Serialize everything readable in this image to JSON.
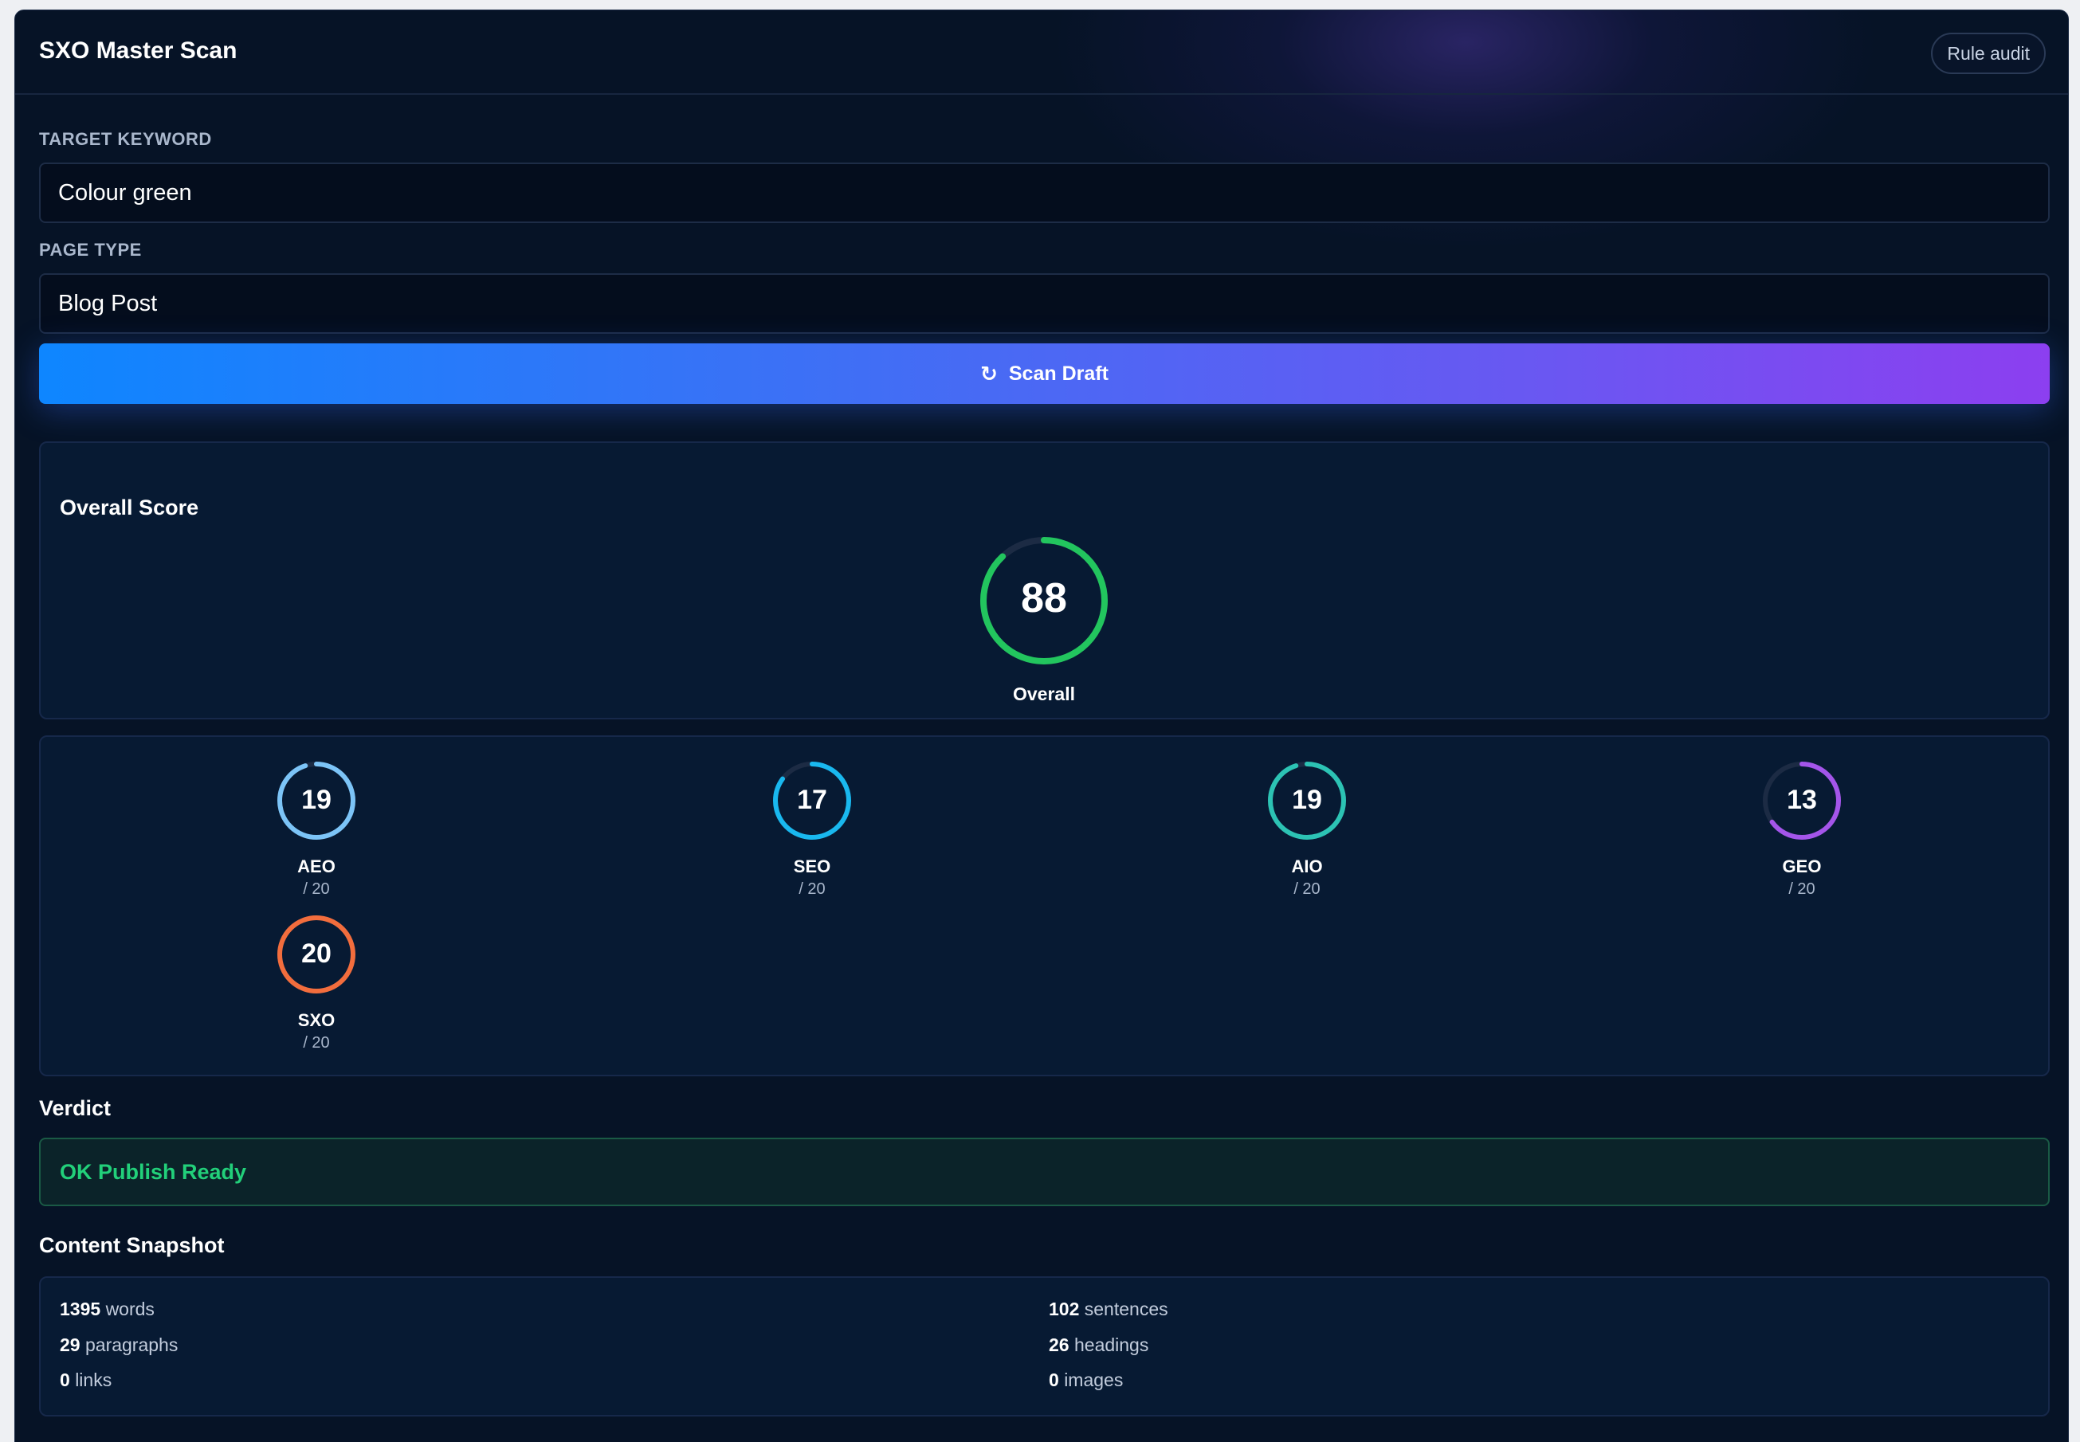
{
  "header": {
    "title": "SXO Master Scan",
    "rule_audit_label": "Rule audit"
  },
  "form": {
    "keyword_label": "TARGET KEYWORD",
    "keyword_value": "Colour green",
    "page_type_label": "PAGE TYPE",
    "page_type_value": "Blog Post",
    "scan_label": "Scan Draft"
  },
  "overall": {
    "title": "Overall Score",
    "value": "88",
    "fraction": 0.88,
    "label": "Overall",
    "color": "#22c55e"
  },
  "scores": [
    {
      "value": "19",
      "fraction": 0.95,
      "label": "AEO",
      "max": "/ 20",
      "color": "#7cc4f7"
    },
    {
      "value": "17",
      "fraction": 0.85,
      "label": "SEO",
      "max": "/ 20",
      "color": "#19b8ef"
    },
    {
      "value": "19",
      "fraction": 0.95,
      "label": "AIO",
      "max": "/ 20",
      "color": "#2cc3b4"
    },
    {
      "value": "13",
      "fraction": 0.65,
      "label": "GEO",
      "max": "/ 20",
      "color": "#a455ea"
    },
    {
      "value": "20",
      "fraction": 1.0,
      "label": "SXO",
      "max": "/ 20",
      "color": "#f26d3d"
    }
  ],
  "verdict": {
    "title": "Verdict",
    "text": "OK Publish Ready",
    "color": "#22d07a"
  },
  "snapshot": {
    "title": "Content Snapshot",
    "stats": [
      {
        "num": "1395",
        "unit": "words"
      },
      {
        "num": "102",
        "unit": "sentences"
      },
      {
        "num": "29",
        "unit": "paragraphs"
      },
      {
        "num": "26",
        "unit": "headings"
      },
      {
        "num": "0",
        "unit": "links"
      },
      {
        "num": "0",
        "unit": "images"
      }
    ]
  }
}
